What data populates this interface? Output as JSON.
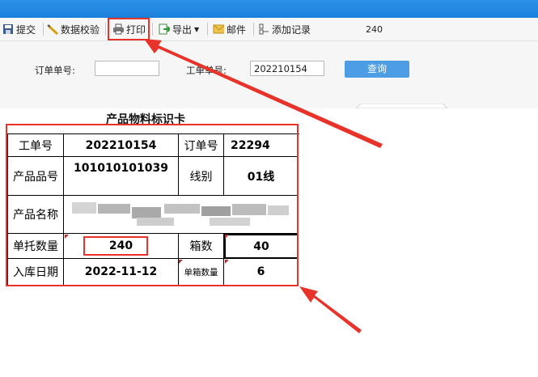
{
  "toolbar": {
    "submit": "提交",
    "validate": "数据校验",
    "print": "打印",
    "export": "导出",
    "mail": "邮件",
    "add_record": "添加记录",
    "count": "240"
  },
  "search": {
    "order_label": "订单单号:",
    "order_value": "",
    "work_label": "工单单号:",
    "work_value": "202210154",
    "query_button": "查询"
  },
  "card": {
    "title": "产品物料标识卡",
    "work_order_label": "工单号",
    "work_order_value": "202210154",
    "order_no_label": "订单号",
    "order_no_value": "22294",
    "product_code_label": "产品品号",
    "product_code_value": "101010101039",
    "line_label": "线别",
    "line_value": "01线",
    "product_name_label": "产品名称",
    "pallet_qty_label": "单托数量",
    "pallet_qty_value": "240",
    "box_count_label": "箱数",
    "box_count_value": "40",
    "storage_date_label": "入库日期",
    "storage_date_value": "2022-11-12",
    "per_box_label": "单箱数量",
    "per_box_value": "6"
  },
  "colors": {
    "titlebar": "#1e88e5",
    "accent_red": "#e8332a",
    "button": "#4d9de4"
  }
}
